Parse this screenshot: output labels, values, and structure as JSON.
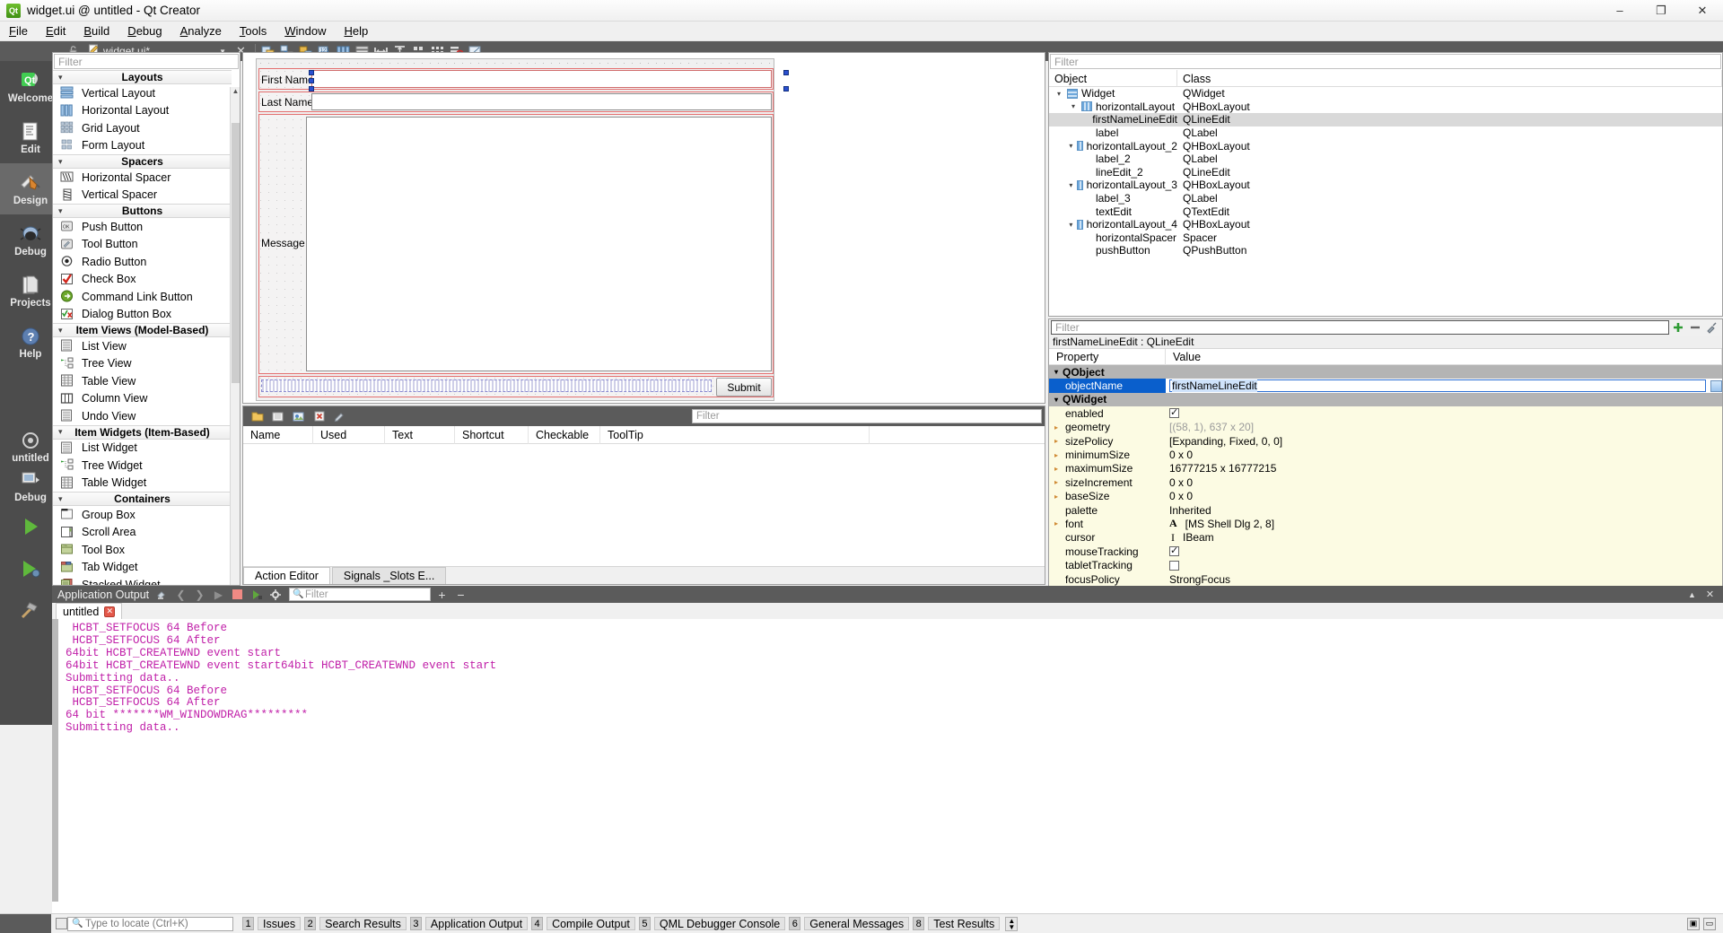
{
  "window": {
    "title": "widget.ui @ untitled - Qt Creator",
    "app_icon": "qt-logo-icon",
    "controls": {
      "minimize": "–",
      "maximize": "❐",
      "close": "✕"
    }
  },
  "menubar": {
    "items": [
      {
        "label": "File",
        "accel": "F"
      },
      {
        "label": "Edit",
        "accel": "E"
      },
      {
        "label": "Build",
        "accel": "B"
      },
      {
        "label": "Debug",
        "accel": "D"
      },
      {
        "label": "Analyze",
        "accel": "A"
      },
      {
        "label": "Tools",
        "accel": "T"
      },
      {
        "label": "Window",
        "accel": "W"
      },
      {
        "label": "Help",
        "accel": "H"
      }
    ]
  },
  "modebar": {
    "items": [
      {
        "label": "Welcome",
        "icon": "qt-welcome-icon",
        "active": false
      },
      {
        "label": "Edit",
        "icon": "document-edit-icon",
        "active": false
      },
      {
        "label": "Design",
        "icon": "ruler-pencil-icon",
        "active": true
      },
      {
        "label": "Debug",
        "icon": "bug-icon",
        "active": false
      },
      {
        "label": "Projects",
        "icon": "folders-icon",
        "active": false
      },
      {
        "label": "Help",
        "icon": "question-circle-icon",
        "active": false
      }
    ],
    "bottom": [
      {
        "label": "untitled",
        "icon": "target-icon"
      },
      {
        "label": "Debug",
        "icon": "computer-icon"
      },
      {
        "label": "",
        "icon": "run-play-icon"
      },
      {
        "label": "",
        "icon": "debug-play-icon"
      },
      {
        "label": "",
        "icon": "build-hammer-icon"
      }
    ]
  },
  "editor_toolbar": {
    "lock_icon": "unlock-icon",
    "file_label": "widget.ui*",
    "file_icon": "ui-file-icon",
    "dropdown_icon": "chevron-down-icon",
    "close_icon": "close-icon",
    "buttons": [
      {
        "icon": "edit-widgets-icon",
        "name": "edit-widgets"
      },
      {
        "icon": "edit-signals-slots-icon",
        "name": "edit-signals-slots"
      },
      {
        "icon": "edit-buddies-icon",
        "name": "edit-buddies"
      },
      {
        "icon": "edit-tab-order-icon",
        "name": "edit-tab-order"
      },
      {
        "icon": "layout-horizontal-icon",
        "name": "lay-out-horizontally"
      },
      {
        "icon": "layout-vertical-icon",
        "name": "lay-out-vertically"
      },
      {
        "icon": "layout-splitter-h-icon",
        "name": "lay-out-in-splitter-horizontally"
      },
      {
        "icon": "layout-splitter-v-icon",
        "name": "lay-out-in-splitter-vertically"
      },
      {
        "icon": "layout-form-icon",
        "name": "lay-out-in-form-layout"
      },
      {
        "icon": "layout-grid-icon",
        "name": "lay-out-in-grid"
      },
      {
        "icon": "break-layout-icon",
        "name": "break-layout"
      },
      {
        "icon": "adjust-size-icon",
        "name": "adjust-size"
      }
    ]
  },
  "widgetbox": {
    "filter_placeholder": "Filter",
    "sections": [
      {
        "title": "Layouts",
        "items": [
          {
            "label": "Vertical Layout",
            "icon": "vertical-layout-icon"
          },
          {
            "label": "Horizontal Layout",
            "icon": "horizontal-layout-icon"
          },
          {
            "label": "Grid Layout",
            "icon": "grid-layout-icon"
          },
          {
            "label": "Form Layout",
            "icon": "form-layout-icon"
          }
        ]
      },
      {
        "title": "Spacers",
        "items": [
          {
            "label": "Horizontal Spacer",
            "icon": "horizontal-spacer-icon"
          },
          {
            "label": "Vertical Spacer",
            "icon": "vertical-spacer-icon"
          }
        ]
      },
      {
        "title": "Buttons",
        "items": [
          {
            "label": "Push Button",
            "icon": "push-button-icon"
          },
          {
            "label": "Tool Button",
            "icon": "tool-button-icon"
          },
          {
            "label": "Radio Button",
            "icon": "radio-button-icon"
          },
          {
            "label": "Check Box",
            "icon": "check-box-icon"
          },
          {
            "label": "Command Link Button",
            "icon": "command-link-button-icon"
          },
          {
            "label": "Dialog Button Box",
            "icon": "dialog-button-box-icon"
          }
        ]
      },
      {
        "title": "Item Views (Model-Based)",
        "items": [
          {
            "label": "List View",
            "icon": "list-view-icon"
          },
          {
            "label": "Tree View",
            "icon": "tree-view-icon"
          },
          {
            "label": "Table View",
            "icon": "table-view-icon"
          },
          {
            "label": "Column View",
            "icon": "column-view-icon"
          },
          {
            "label": "Undo View",
            "icon": "undo-view-icon"
          }
        ]
      },
      {
        "title": "Item Widgets (Item-Based)",
        "items": [
          {
            "label": "List Widget",
            "icon": "list-widget-icon"
          },
          {
            "label": "Tree Widget",
            "icon": "tree-widget-icon"
          },
          {
            "label": "Table Widget",
            "icon": "table-widget-icon"
          }
        ]
      },
      {
        "title": "Containers",
        "items": [
          {
            "label": "Group Box",
            "icon": "group-box-icon"
          },
          {
            "label": "Scroll Area",
            "icon": "scroll-area-icon"
          },
          {
            "label": "Tool Box",
            "icon": "tool-box-icon"
          },
          {
            "label": "Tab Widget",
            "icon": "tab-widget-icon"
          },
          {
            "label": "Stacked Widget",
            "icon": "stacked-widget-icon"
          }
        ]
      }
    ]
  },
  "form": {
    "first_name_label": "First Name",
    "first_name_value": "",
    "last_name_label": "Last Name",
    "last_name_value": "",
    "message_label": "Message",
    "message_value": "",
    "submit_label": "Submit",
    "spacer_name": "horizontalSpacer"
  },
  "action_editor": {
    "toolbar_icons": [
      {
        "icon": "new-action-icon",
        "name": "new-action"
      },
      {
        "icon": "view-list-icon",
        "name": "list-view-mode"
      },
      {
        "icon": "view-icons-icon",
        "name": "icon-view-mode"
      },
      {
        "icon": "delete-action-icon",
        "name": "delete-action"
      },
      {
        "icon": "edit-action-icon",
        "name": "edit-action"
      }
    ],
    "filter_placeholder": "Filter",
    "columns": [
      "Name",
      "Used",
      "Text",
      "Shortcut",
      "Checkable",
      "ToolTip"
    ],
    "rows": [],
    "tabs": [
      {
        "label": "Action Editor",
        "active": true
      },
      {
        "label": "Signals _Slots E...",
        "active": false
      }
    ]
  },
  "object_inspector": {
    "filter_placeholder": "Filter",
    "columns": [
      "Object",
      "Class"
    ],
    "rows": [
      {
        "indent": 0,
        "name": "Widget",
        "class": "QWidget",
        "icon": "vertical-layout-icon",
        "expandable": true,
        "selected": false
      },
      {
        "indent": 1,
        "name": "horizontalLayout",
        "class": "QHBoxLayout",
        "icon": "horizontal-layout-icon",
        "expandable": true,
        "selected": false
      },
      {
        "indent": 2,
        "name": "firstNameLineEdit",
        "class": "QLineEdit",
        "icon": "",
        "expandable": false,
        "selected": true
      },
      {
        "indent": 2,
        "name": "label",
        "class": "QLabel",
        "icon": "",
        "expandable": false,
        "selected": false
      },
      {
        "indent": 1,
        "name": "horizontalLayout_2",
        "class": "QHBoxLayout",
        "icon": "horizontal-layout-icon",
        "expandable": true,
        "selected": false
      },
      {
        "indent": 2,
        "name": "label_2",
        "class": "QLabel",
        "icon": "",
        "expandable": false,
        "selected": false
      },
      {
        "indent": 2,
        "name": "lineEdit_2",
        "class": "QLineEdit",
        "icon": "",
        "expandable": false,
        "selected": false
      },
      {
        "indent": 1,
        "name": "horizontalLayout_3",
        "class": "QHBoxLayout",
        "icon": "horizontal-layout-icon",
        "expandable": true,
        "selected": false
      },
      {
        "indent": 2,
        "name": "label_3",
        "class": "QLabel",
        "icon": "",
        "expandable": false,
        "selected": false
      },
      {
        "indent": 2,
        "name": "textEdit",
        "class": "QTextEdit",
        "icon": "",
        "expandable": false,
        "selected": false
      },
      {
        "indent": 1,
        "name": "horizontalLayout_4",
        "class": "QHBoxLayout",
        "icon": "horizontal-layout-icon",
        "expandable": true,
        "selected": false
      },
      {
        "indent": 2,
        "name": "horizontalSpacer",
        "class": "Spacer",
        "icon": "",
        "expandable": false,
        "selected": false
      },
      {
        "indent": 2,
        "name": "pushButton",
        "class": "QPushButton",
        "icon": "",
        "expandable": false,
        "selected": false
      }
    ]
  },
  "property_editor": {
    "filter_placeholder": "Filter",
    "buttons": [
      {
        "icon": "add-dynamic-property-icon",
        "name": "add-dynamic-property"
      },
      {
        "icon": "remove-dynamic-property-icon",
        "name": "remove-dynamic-property"
      },
      {
        "icon": "configure-icon",
        "name": "configure"
      }
    ],
    "object_header": "firstNameLineEdit : QLineEdit",
    "columns": [
      "Property",
      "Value"
    ],
    "rows": [
      {
        "group": true,
        "name": "QObject"
      },
      {
        "name": "objectName",
        "value": "firstNameLineEdit",
        "type": "editing",
        "selected": true
      },
      {
        "group": true,
        "name": "QWidget"
      },
      {
        "name": "enabled",
        "value": "",
        "type": "checkbox",
        "checked": true,
        "alt": true
      },
      {
        "name": "geometry",
        "value": "[(58, 1), 637 x 20]",
        "type": "gray",
        "expandable": true,
        "alt": true
      },
      {
        "name": "sizePolicy",
        "value": "[Expanding, Fixed, 0, 0]",
        "type": "text",
        "expandable": true,
        "alt": true
      },
      {
        "name": "minimumSize",
        "value": "0 x 0",
        "type": "text",
        "expandable": true,
        "alt": true
      },
      {
        "name": "maximumSize",
        "value": "16777215 x 16777215",
        "type": "text",
        "expandable": true,
        "alt": true
      },
      {
        "name": "sizeIncrement",
        "value": "0 x 0",
        "type": "text",
        "expandable": true,
        "alt": true
      },
      {
        "name": "baseSize",
        "value": "0 x 0",
        "type": "text",
        "expandable": true,
        "alt": true
      },
      {
        "name": "palette",
        "value": "Inherited",
        "type": "text",
        "alt": true
      },
      {
        "name": "font",
        "value": "[MS Shell Dlg 2, 8]",
        "type": "font",
        "expandable": true,
        "alt": true
      },
      {
        "name": "cursor",
        "value": "IBeam",
        "type": "cursor",
        "alt": true
      },
      {
        "name": "mouseTracking",
        "value": "",
        "type": "checkbox",
        "checked": true,
        "alt": true
      },
      {
        "name": "tabletTracking",
        "value": "",
        "type": "checkbox",
        "checked": false,
        "alt": true
      },
      {
        "name": "focusPolicy",
        "value": "StrongFocus",
        "type": "text",
        "alt": true
      }
    ]
  },
  "application_output": {
    "panel_title": "Application Output",
    "toolbar_icons": [
      {
        "icon": "clear-output-icon",
        "name": "clear"
      },
      {
        "icon": "prev-item-icon",
        "name": "previous-item"
      },
      {
        "icon": "next-item-icon",
        "name": "next-item"
      },
      {
        "icon": "run-icon",
        "name": "run"
      },
      {
        "icon": "stop-icon",
        "name": "stop"
      },
      {
        "icon": "attach-debugger-icon",
        "name": "attach-debugger"
      },
      {
        "icon": "settings-gear-icon",
        "name": "settings"
      }
    ],
    "filter_placeholder": "Filter",
    "right_icons": [
      {
        "icon": "maximize-panel-icon",
        "name": "maximize-output-pane"
      },
      {
        "icon": "close-panel-icon",
        "name": "close-output-pane"
      }
    ],
    "tab": {
      "label": "untitled",
      "close_icon": "close-icon"
    },
    "lines": [
      " HCBT_SETFOCUS 64 Before",
      " HCBT_SETFOCUS 64 After",
      "64bit HCBT_CREATEWND event start",
      "64bit HCBT_CREATEWND event start64bit HCBT_CREATEWND event start",
      "Submitting data..",
      " HCBT_SETFOCUS 64 Before",
      " HCBT_SETFOCUS 64 After",
      "64 bit *******WM_WINDOWDRAG*********",
      "Submitting data.."
    ],
    "text_color": "#c01fa8"
  },
  "statusbar": {
    "locator_placeholder": "Type to locate (Ctrl+K)",
    "panels": [
      {
        "num": "1",
        "label": "Issues"
      },
      {
        "num": "2",
        "label": "Search Results"
      },
      {
        "num": "3",
        "label": "Application Output"
      },
      {
        "num": "4",
        "label": "Compile Output"
      },
      {
        "num": "5",
        "label": "QML Debugger Console"
      },
      {
        "num": "6",
        "label": "General Messages"
      },
      {
        "num": "8",
        "label": "Test Results"
      }
    ],
    "right_icons": [
      {
        "icon": "maximize-icon",
        "name": "maximize-output-pane"
      },
      {
        "icon": "minimize-icon",
        "name": "minimize-output-pane"
      }
    ]
  },
  "colors": {
    "toolbar_dark": "#5b5b5b",
    "mode_bar": "#4c4c4c",
    "selection_blue": "#0a5fcc",
    "property_alt": "#fcfbe3",
    "form_red": "#e36f6f",
    "output_magenta": "#c01fa8"
  }
}
